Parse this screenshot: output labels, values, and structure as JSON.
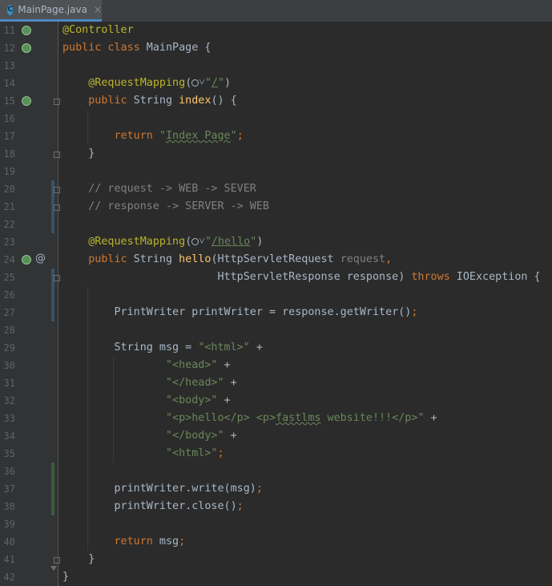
{
  "tab": {
    "filename": "MainPage.java",
    "icon": "C",
    "close": "×"
  },
  "lines": [
    {
      "n": "11",
      "html": "<span class=\"ann\">@Controller</span>"
    },
    {
      "n": "12",
      "html": "<span class=\"kw\">public class</span> MainPage {"
    },
    {
      "n": "13",
      "html": ""
    },
    {
      "n": "14",
      "html": "    <span class=\"ann\">@RequestMapping</span>(<span class=\"globe\"></span>˅<span class=\"str\">\"<u>/</u>\"</span>)"
    },
    {
      "n": "15",
      "html": "    <span class=\"kw\">public</span> String <span class=\"fn\">index</span>() {"
    },
    {
      "n": "16",
      "html": ""
    },
    {
      "n": "17",
      "html": "        <span class=\"kw\">return</span> <span class=\"str\">\"<span class=\"uline\">Index Page</span>\"</span><span class=\"kw\">;</span>"
    },
    {
      "n": "18",
      "html": "    }"
    },
    {
      "n": "19",
      "html": ""
    },
    {
      "n": "20",
      "html": "    <span class=\"cm\">// request -> WEB -> SEVER</span>"
    },
    {
      "n": "21",
      "html": "    <span class=\"cm\">// response -> SERVER -> WEB</span>"
    },
    {
      "n": "22",
      "html": ""
    },
    {
      "n": "23",
      "html": "    <span class=\"ann\">@RequestMapping</span>(<span class=\"globe\"></span>˅<span class=\"str\">\"<u>/hello</u>\"</span>)"
    },
    {
      "n": "24",
      "html": "    <span class=\"kw\">public</span> String <span class=\"fn\">hello</span>(HttpServletRequest <span class=\"param\">request</span><span class=\"kw\">,</span>"
    },
    {
      "n": "25",
      "html": "                        HttpServletResponse response) <span class=\"kw\">throws</span> IOException {"
    },
    {
      "n": "26",
      "html": ""
    },
    {
      "n": "27",
      "html": "        PrintWriter printWriter = response.getWriter()<span class=\"kw\">;</span>"
    },
    {
      "n": "28",
      "html": ""
    },
    {
      "n": "29",
      "html": "        String msg = <span class=\"str\">\"&lt;html&gt;\"</span> +"
    },
    {
      "n": "30",
      "html": "                <span class=\"str\">\"&lt;head&gt;\"</span> +"
    },
    {
      "n": "31",
      "html": "                <span class=\"str\">\"&lt;/head&gt;\"</span> +"
    },
    {
      "n": "32",
      "html": "                <span class=\"str\">\"&lt;body&gt;\"</span> +"
    },
    {
      "n": "33",
      "html": "                <span class=\"str\">\"&lt;p&gt;hello&lt;/p&gt; &lt;p&gt;<span class=\"uline\">fastlms</span> website!!!&lt;/p&gt;\"</span> +"
    },
    {
      "n": "34",
      "html": "                <span class=\"str\">\"&lt;/body&gt;\"</span> +"
    },
    {
      "n": "35",
      "html": "                <span class=\"str\">\"&lt;html&gt;\"</span><span class=\"kw\">;</span>"
    },
    {
      "n": "36",
      "html": ""
    },
    {
      "n": "37",
      "html": "        printWriter.write(msg)<span class=\"kw\">;</span>"
    },
    {
      "n": "38",
      "html": "        printWriter.close()<span class=\"kw\">;</span>"
    },
    {
      "n": "39",
      "html": ""
    },
    {
      "n": "40",
      "html": "        <span class=\"kw\">return</span> msg<span class=\"kw\">;</span>"
    },
    {
      "n": "41",
      "html": "    }"
    },
    {
      "n": "42",
      "html": "}"
    }
  ]
}
